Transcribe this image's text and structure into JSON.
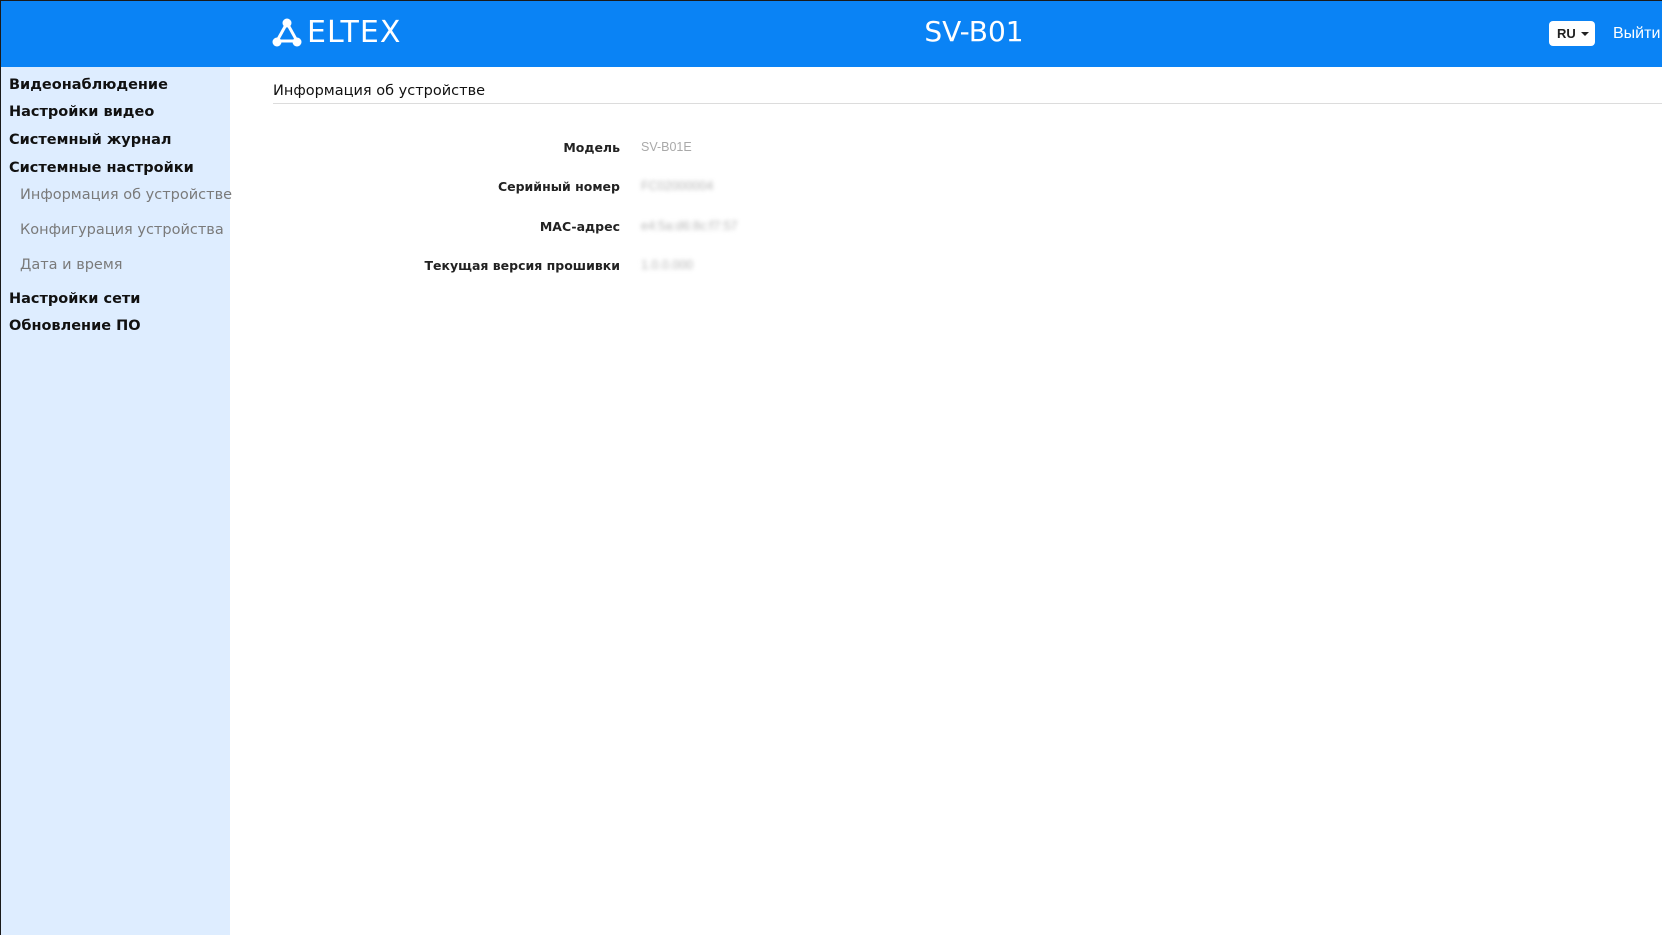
{
  "header": {
    "brand": "ELTEX",
    "title": "SV-B01",
    "language": "RU",
    "logout_label": "Выйти",
    "background_color": "#0a83f5"
  },
  "sidebar": {
    "background_color": "#deedff",
    "items": [
      {
        "label": "Видеонаблюдение"
      },
      {
        "label": "Настройки видео"
      },
      {
        "label": "Системный журнал"
      },
      {
        "label": "Системные настройки"
      },
      {
        "label": "Настройки сети"
      },
      {
        "label": "Обновление ПО"
      }
    ],
    "subitems": [
      {
        "label": "Информация об устройстве"
      },
      {
        "label": "Конфигурация устройства"
      },
      {
        "label": "Дата и время"
      }
    ]
  },
  "main": {
    "section_title": "Информация об устройстве",
    "fields": [
      {
        "label": "Модель",
        "value": "SV-B01E"
      },
      {
        "label": "Серийный номер",
        "value": "FC02000004"
      },
      {
        "label": "MAC-адрес",
        "value": "e4:5a:d6:8c:f7:57"
      },
      {
        "label": "Текущая версия прошивки",
        "value": "1.0.0.000"
      }
    ]
  }
}
